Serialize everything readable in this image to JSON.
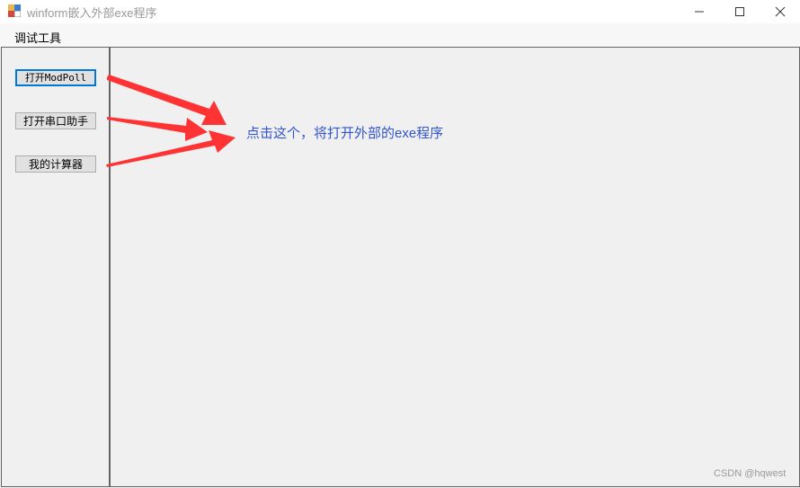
{
  "window": {
    "title": "winform嵌入外部exe程序",
    "controls": [
      "minimize",
      "maximize",
      "close"
    ]
  },
  "menubar": {
    "items": [
      {
        "label": "调试工具"
      }
    ]
  },
  "left_panel": {
    "buttons": [
      {
        "label": "打开ModPoll",
        "focused": true
      },
      {
        "label": "打开串口助手",
        "focused": false
      },
      {
        "label": "我的计算器",
        "focused": false
      }
    ]
  },
  "annotation": {
    "text": "点击这个，将打开外部的exe程序",
    "color": "#3355cc",
    "arrow_color": "#ff3333"
  },
  "watermark": {
    "text": "CSDN @hqwest"
  },
  "colors": {
    "focus_border": "#0078d7",
    "panel_border": "#646464",
    "background": "#f0f0f0"
  }
}
